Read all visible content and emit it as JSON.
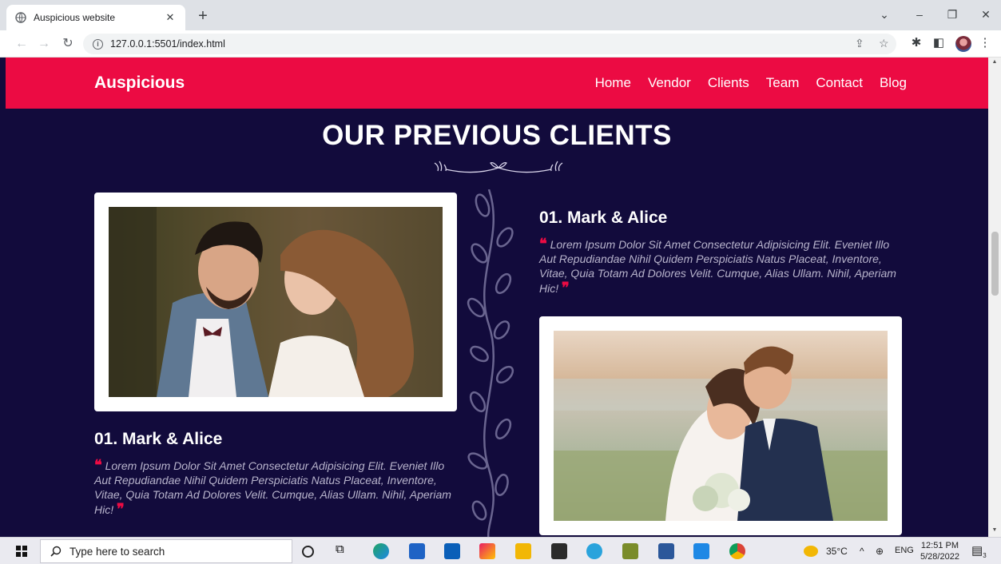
{
  "browser": {
    "tab_title": "Auspicious website",
    "tab_close": "✕",
    "new_tab": "+",
    "url": "127.0.0.1:5501/index.html",
    "window_controls": [
      "⌄",
      "–",
      "❐",
      "✕"
    ]
  },
  "site": {
    "brand": "Auspicious",
    "nav": [
      "Home",
      "Vendor",
      "Clients",
      "Team",
      "Contact",
      "Blog"
    ],
    "section_title": "OUR PREVIOUS CLIENTS",
    "clients": [
      {
        "name": "01. Mark & Alice",
        "description": "Lorem Ipsum Dolor Sit Amet Consectetur Adipisicing Elit. Eveniet Illo Aut Repudiandae Nihil Quidem Perspiciatis Natus Placeat, Inventore, Vitae, Quia Totam Ad Dolores Velit. Cumque, Alias Ullam. Nihil, Aperiam Hic!"
      },
      {
        "name": "01. Mark & Alice",
        "description": "Lorem Ipsum Dolor Sit Amet Consectetur Adipisicing Elit. Eveniet Illo Aut Repudiandae Nihil Quidem Perspiciatis Natus Placeat, Inventore, Vitae, Quia Totam Ad Dolores Velit. Cumque, Alias Ullam. Nihil, Aperiam Hic!"
      }
    ],
    "quote_open": "❝",
    "quote_close": "❞"
  },
  "taskbar": {
    "search_placeholder": "Type here to search",
    "weather": "35°C",
    "language": "ENG",
    "time": "12:51 PM",
    "date": "5/28/2022",
    "notifications": "3"
  },
  "colors": {
    "nav_bg": "#ec0b43",
    "page_bg": "#120b3c",
    "accent": "#ec0b43"
  }
}
